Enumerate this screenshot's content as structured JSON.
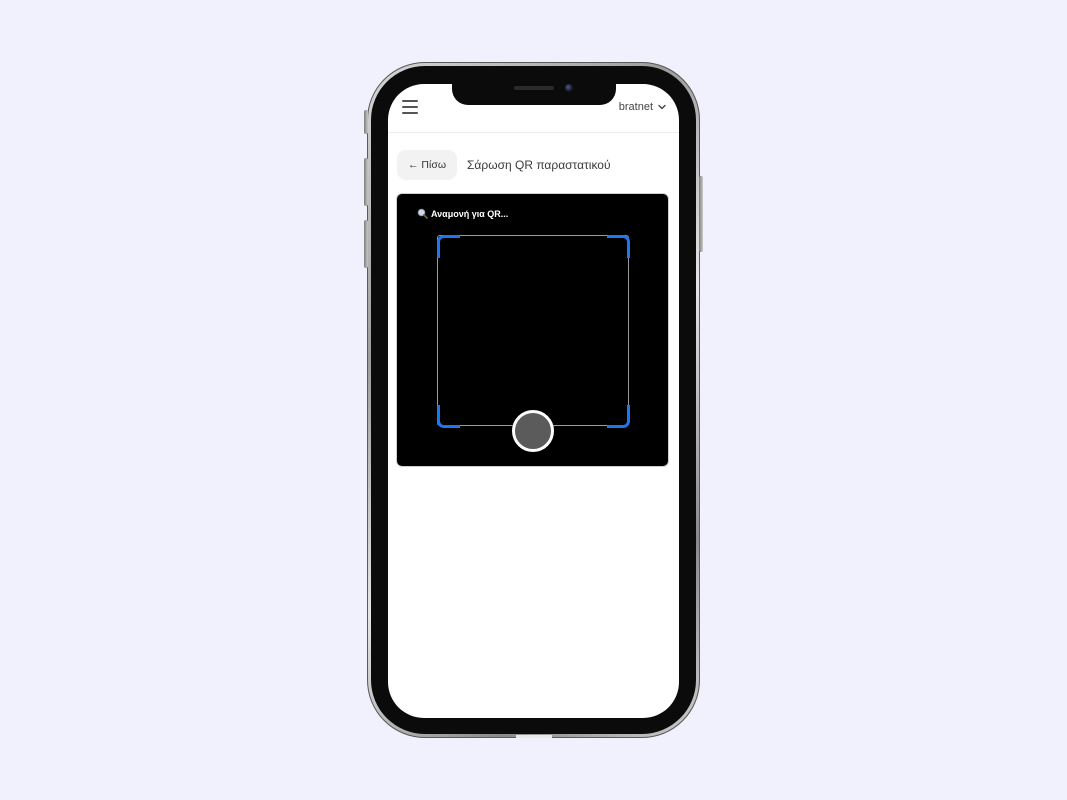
{
  "topbar": {
    "menu_icon": "hamburger-menu-icon",
    "account_name": "bratnet",
    "account_icon": "chevron-down-icon"
  },
  "header": {
    "back_label": "← Πίσω",
    "title": "Σάρωση QR παραστατικού"
  },
  "scanner": {
    "status_icon": "magnifier-icon",
    "status_text": "Αναμονή για QR...",
    "accent_color": "#1e76f0",
    "background_color": "#000000"
  },
  "page": {
    "background_color": "#f1f1fd"
  }
}
